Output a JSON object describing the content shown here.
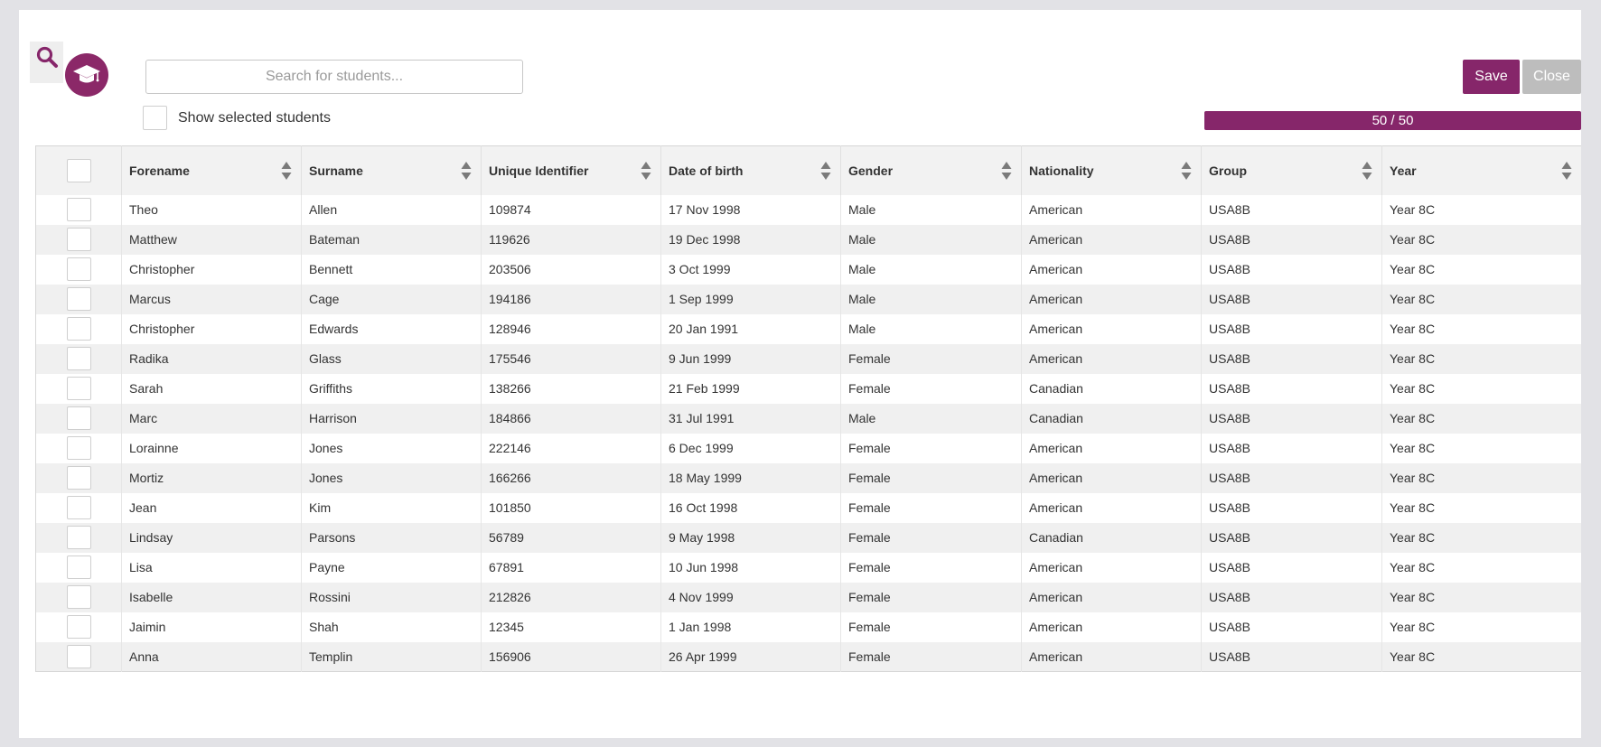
{
  "search": {
    "placeholder": "Search for students..."
  },
  "icons": {
    "search": "search-icon",
    "avatar": "graduation-cap-icon"
  },
  "show_selected_label": "Show selected students",
  "buttons": {
    "save": "Save",
    "close": "Close"
  },
  "progress": {
    "text": "50 / 50",
    "value": 50,
    "max": 50
  },
  "colors": {
    "accent": "#86266a",
    "close_button": "#bdbdbd"
  },
  "table": {
    "columns": [
      "Forename",
      "Surname",
      "Unique Identifier",
      "Date of birth",
      "Gender",
      "Nationality",
      "Group",
      "Year"
    ],
    "rows": [
      [
        "Theo",
        "Allen",
        "109874",
        "17 Nov 1998",
        "Male",
        "American",
        "USA8B",
        "Year 8C"
      ],
      [
        "Matthew",
        "Bateman",
        "119626",
        "19 Dec 1998",
        "Male",
        "American",
        "USA8B",
        "Year 8C"
      ],
      [
        "Christopher",
        "Bennett",
        "203506",
        "3 Oct 1999",
        "Male",
        "American",
        "USA8B",
        "Year 8C"
      ],
      [
        "Marcus",
        "Cage",
        "194186",
        "1 Sep 1999",
        "Male",
        "American",
        "USA8B",
        "Year 8C"
      ],
      [
        "Christopher",
        "Edwards",
        "128946",
        "20 Jan 1991",
        "Male",
        "American",
        "USA8B",
        "Year 8C"
      ],
      [
        "Radika",
        "Glass",
        "175546",
        "9 Jun 1999",
        "Female",
        "American",
        "USA8B",
        "Year 8C"
      ],
      [
        "Sarah",
        "Griffiths",
        "138266",
        "21 Feb 1999",
        "Female",
        "Canadian",
        "USA8B",
        "Year 8C"
      ],
      [
        "Marc",
        "Harrison",
        "184866",
        "31 Jul 1991",
        "Male",
        "Canadian",
        "USA8B",
        "Year 8C"
      ],
      [
        "Lorainne",
        "Jones",
        "222146",
        "6 Dec 1999",
        "Female",
        "American",
        "USA8B",
        "Year 8C"
      ],
      [
        "Mortiz",
        "Jones",
        "166266",
        "18 May 1999",
        "Female",
        "American",
        "USA8B",
        "Year 8C"
      ],
      [
        "Jean",
        "Kim",
        "101850",
        "16 Oct 1998",
        "Female",
        "American",
        "USA8B",
        "Year 8C"
      ],
      [
        "Lindsay",
        "Parsons",
        "56789",
        "9 May 1998",
        "Female",
        "Canadian",
        "USA8B",
        "Year 8C"
      ],
      [
        "Lisa",
        "Payne",
        "67891",
        "10 Jun 1998",
        "Female",
        "American",
        "USA8B",
        "Year 8C"
      ],
      [
        "Isabelle",
        "Rossini",
        "212826",
        "4 Nov 1999",
        "Female",
        "American",
        "USA8B",
        "Year 8C"
      ],
      [
        "Jaimin",
        "Shah",
        "12345",
        "1 Jan 1998",
        "Female",
        "American",
        "USA8B",
        "Year 8C"
      ],
      [
        "Anna",
        "Templin",
        "156906",
        "26 Apr 1999",
        "Female",
        "American",
        "USA8B",
        "Year 8C"
      ]
    ]
  }
}
